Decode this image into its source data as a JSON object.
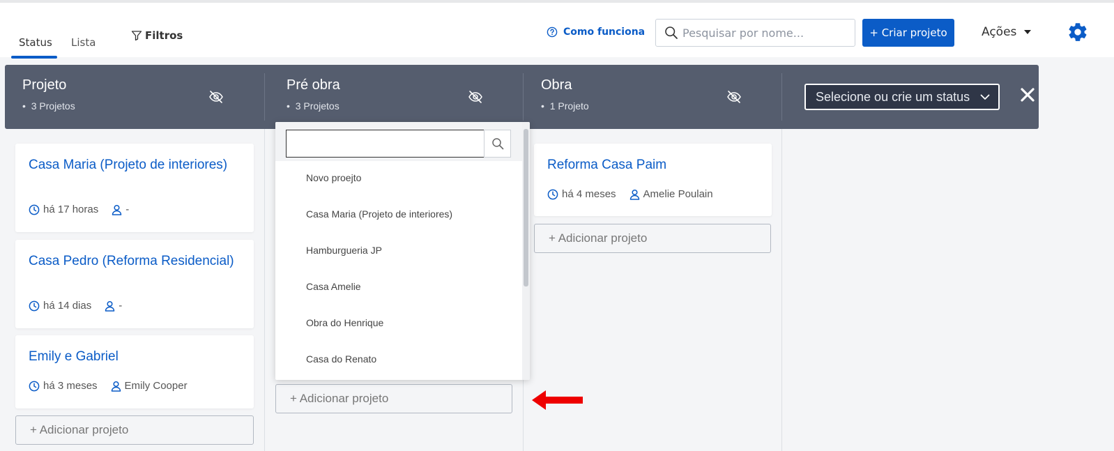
{
  "tabs": [
    {
      "label": "Status"
    },
    {
      "label": "Lista"
    }
  ],
  "filters_label": "Filtros",
  "how_it_works_label": "Como funciona",
  "search": {
    "placeholder": "Pesquisar por nome..."
  },
  "create_button_label": "+ Criar projeto",
  "actions_label": "Ações",
  "columns": [
    {
      "title": "Projeto",
      "count": "3 Projetos"
    },
    {
      "title": "Pré obra",
      "count": "3 Projetos"
    },
    {
      "title": "Obra",
      "count": "1 Projeto"
    }
  ],
  "status_select_label": "Selecione ou crie um status",
  "cards": [
    {
      "title": "Casa Maria (Projeto de interiores)",
      "time": "há 17 horas",
      "owner": "-"
    },
    {
      "title": "Casa Pedro (Reforma Residencial)",
      "time": "há 14 dias",
      "owner": "-"
    },
    {
      "title": "Emily e Gabriel",
      "time": "há 3 meses",
      "owner": "Emily Cooper"
    },
    {
      "title": "Reforma Casa Paim",
      "time": "há 4 meses",
      "owner": "Amelie Poulain"
    }
  ],
  "add_project_label": "+ Adicionar projeto",
  "dropdown": {
    "items": [
      "Novo proejto",
      "Casa Maria (Projeto de interiores)",
      "Hamburgueria JP",
      "Casa Amelie",
      "Obra do Henrique",
      "Casa do Renato"
    ]
  },
  "colors": {
    "primary": "#0b5cc7",
    "header_bg": "#555d6e",
    "arrow": "#ee0000"
  }
}
